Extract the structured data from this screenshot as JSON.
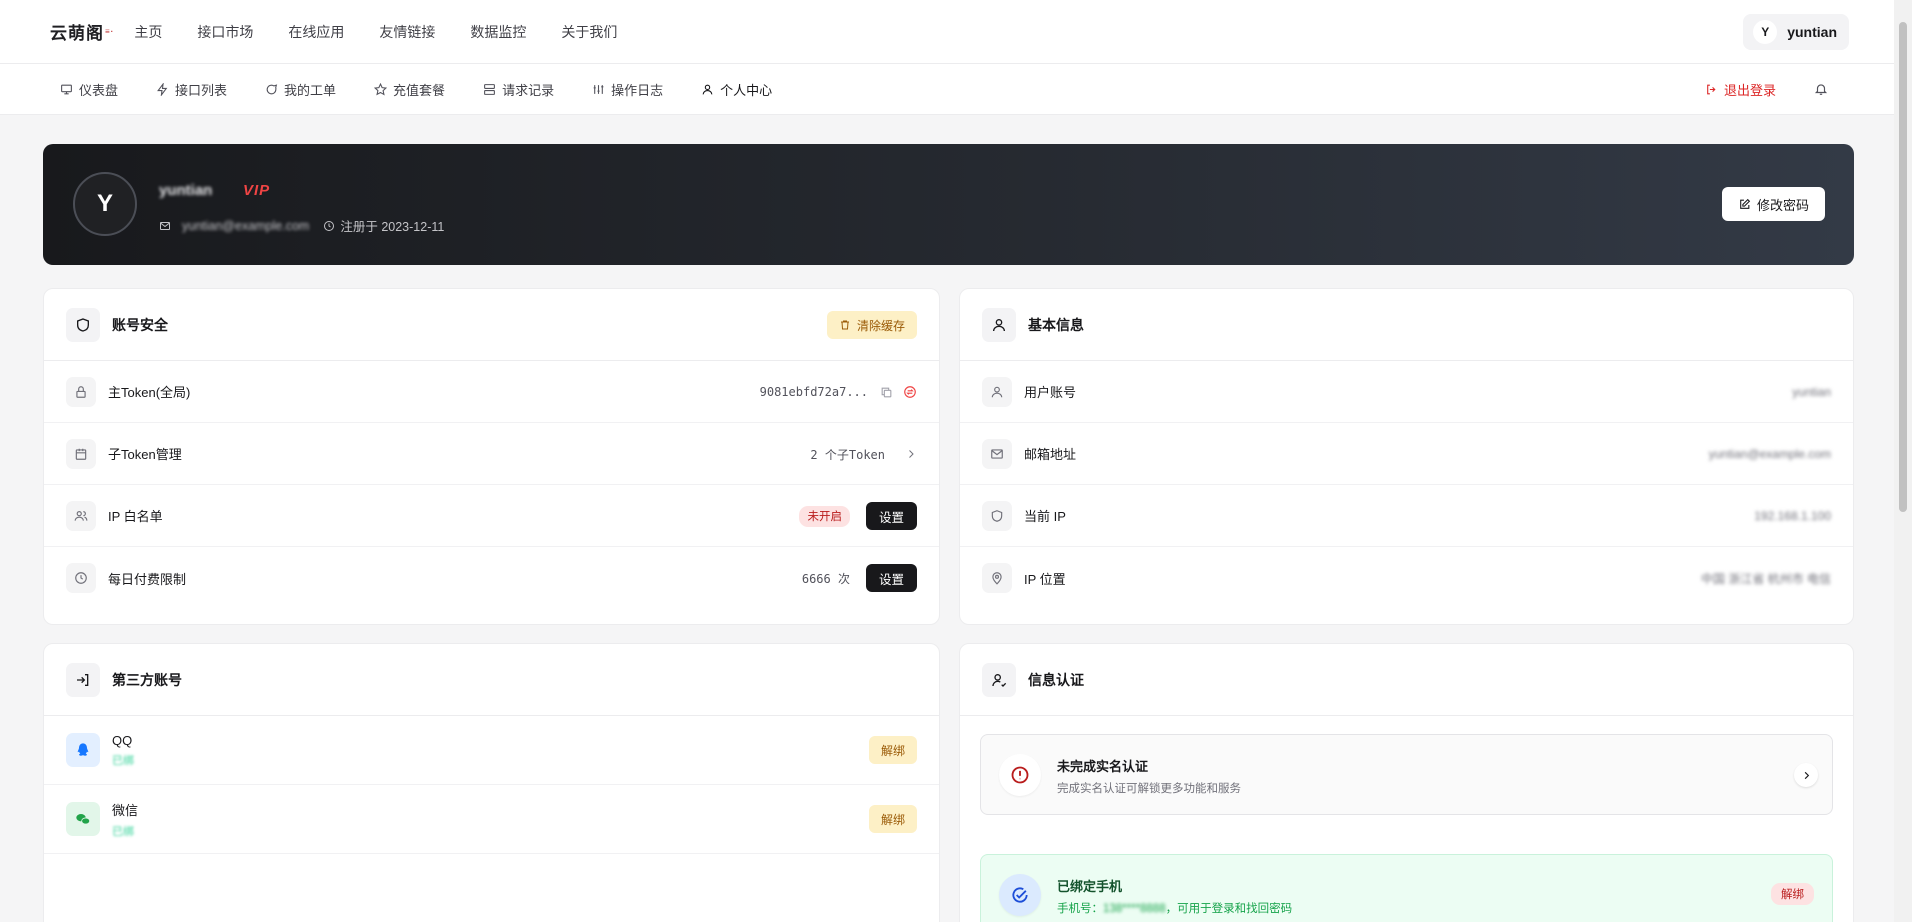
{
  "brand": {
    "logo_text": "云萌阁",
    "logo_dots": "≡·"
  },
  "topnav": {
    "items": [
      "主页",
      "接口市场",
      "在线应用",
      "友情链接",
      "数据监控",
      "关于我们"
    ]
  },
  "user": {
    "avatar_letter": "Y",
    "name": "yuntian"
  },
  "subnav": {
    "tabs": [
      {
        "label": "仪表盘",
        "icon": "monitor-icon"
      },
      {
        "label": "接口列表",
        "icon": "bolt-icon"
      },
      {
        "label": "我的工单",
        "icon": "message-icon"
      },
      {
        "label": "充值套餐",
        "icon": "star-icon"
      },
      {
        "label": "请求记录",
        "icon": "server-icon"
      },
      {
        "label": "操作日志",
        "icon": "sliders-icon"
      },
      {
        "label": "个人中心",
        "icon": "user-icon"
      }
    ],
    "logout": "退出登录"
  },
  "profile": {
    "avatar_letter": "Y",
    "username": "yuntian",
    "vip": "VIP",
    "email": "yuntian@example.com",
    "registered": "注册于 2023-12-11",
    "edit_password": "修改密码"
  },
  "security": {
    "title": "账号安全",
    "clear_cache": "清除缓存",
    "rows": [
      {
        "label": "主Token(全局)",
        "value": "9081ebfd72a7..."
      },
      {
        "label": "子Token管理",
        "value": "2 个子Token"
      },
      {
        "label": "IP 白名单",
        "badge": "未开启",
        "action": "设置"
      },
      {
        "label": "每日付费限制",
        "value": "6666 次",
        "action": "设置"
      }
    ]
  },
  "basic": {
    "title": "基本信息",
    "rows": [
      {
        "label": "用户账号",
        "value": "yuntian"
      },
      {
        "label": "邮箱地址",
        "value": "yuntian@example.com"
      },
      {
        "label": "当前 IP",
        "value": "192.168.1.100"
      },
      {
        "label": "IP 位置",
        "value": "中国 浙江省 杭州市 电信"
      }
    ]
  },
  "third": {
    "title": "第三方账号",
    "items": [
      {
        "name": "QQ",
        "status": "已绑",
        "action": "解绑"
      },
      {
        "name": "微信",
        "status": "已绑",
        "action": "解绑"
      }
    ]
  },
  "auth": {
    "title": "信息认证",
    "realname": {
      "title": "未完成实名认证",
      "desc": "完成实名认证可解锁更多功能和服务"
    },
    "phone": {
      "title": "已绑定手机",
      "prefix": "手机号：",
      "masked": "138****8888",
      "suffix": "，可用于登录和找回密码",
      "action": "解绑"
    }
  },
  "colors": {
    "accent_dark": "#18181b",
    "danger": "#dc2626",
    "amber": "#fdf0c6",
    "success_bg": "#ecfdf3"
  }
}
